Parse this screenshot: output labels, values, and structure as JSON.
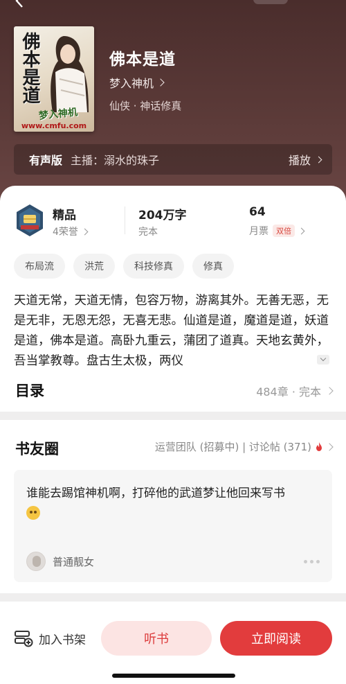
{
  "header": {
    "cover": {
      "title_text": "佛本是道",
      "author_text": "梦入神机",
      "url_text": "www.cmfu.com"
    },
    "book_title": "佛本是道",
    "author": "梦入神机",
    "genre": "仙侠 · 神话修真",
    "audio": {
      "tag": "有声版",
      "host": "主播：溺水的珠子",
      "play_label": "播放"
    }
  },
  "stats": {
    "quality": {
      "title": "精品",
      "sub": "4荣誉"
    },
    "words": {
      "title": "204万字",
      "sub": "完本"
    },
    "tickets": {
      "title": "64",
      "sub": "月票",
      "badge": "双倍"
    }
  },
  "tags": [
    "布局流",
    "洪荒",
    "科技修真",
    "修真"
  ],
  "synopsis": "天道无常，天道无情，包容万物，游离其外。无善无恶，无是无非，无恩无怨，无喜无悲。仙道是道，魔道是道，妖道是道，佛本是道。高卧九重云，蒲团了道真。天地玄黄外，吾当掌教尊。盘古生太极，两仪",
  "toc": {
    "label": "目录",
    "info": "484章 · 完本"
  },
  "community": {
    "title": "书友圈",
    "links": "运营团队 (招募中) | 讨论帖 (371)",
    "post": {
      "text": "谁能去踢馆神机啊，打碎他的武道梦让他回来写书",
      "user": "普通靓女"
    }
  },
  "bottom": {
    "shelf_label": "加入书架",
    "listen_label": "听书",
    "read_label": "立即阅读"
  },
  "colors": {
    "hero_bg": "#4a2d2c",
    "accent_red": "#e23c3d",
    "listen_bg": "#fce4e3"
  }
}
